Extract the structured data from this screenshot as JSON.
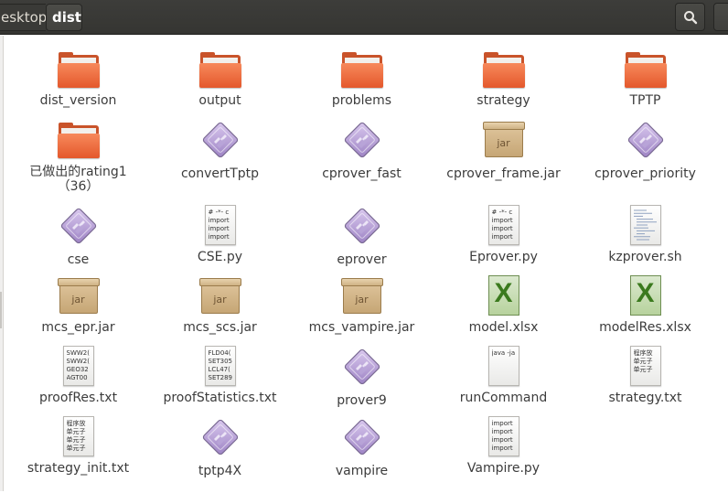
{
  "header": {
    "breadcrumb_prev": "esktop",
    "breadcrumb_current": "dist",
    "search_icon": "search-icon",
    "menu_icon": "menu-icon"
  },
  "files": [
    {
      "name": "dist_version",
      "type": "folder",
      "icon": "folder-icon"
    },
    {
      "name": "output",
      "type": "folder",
      "icon": "folder-icon"
    },
    {
      "name": "problems",
      "type": "folder",
      "icon": "folder-icon"
    },
    {
      "name": "strategy",
      "type": "folder",
      "icon": "folder-icon"
    },
    {
      "name": "TPTP",
      "type": "folder",
      "icon": "folder-icon"
    },
    {
      "name": "已做出的rating1\n（36）",
      "type": "folder",
      "icon": "folder-icon"
    },
    {
      "name": "convertTptp",
      "type": "exec",
      "icon": "executable-icon"
    },
    {
      "name": "cprover_fast",
      "type": "exec",
      "icon": "executable-icon"
    },
    {
      "name": "cprover_frame.jar",
      "type": "jar",
      "icon": "jar-icon",
      "preview": "jar"
    },
    {
      "name": "cprover_priority",
      "type": "exec",
      "icon": "executable-icon"
    },
    {
      "name": "cse",
      "type": "exec",
      "icon": "executable-icon"
    },
    {
      "name": "CSE.py",
      "type": "text",
      "icon": "python-file-icon",
      "preview": "# -*- c\nimport\nimport\nimport"
    },
    {
      "name": "eprover",
      "type": "exec",
      "icon": "executable-icon"
    },
    {
      "name": "Eprover.py",
      "type": "text",
      "icon": "python-file-icon",
      "preview": "# -*- c\nimport\nimport\nimport"
    },
    {
      "name": "kzprover.sh",
      "type": "script",
      "icon": "shell-script-icon"
    },
    {
      "name": "mcs_epr.jar",
      "type": "jar",
      "icon": "jar-icon",
      "preview": "jar"
    },
    {
      "name": "mcs_scs.jar",
      "type": "jar",
      "icon": "jar-icon",
      "preview": "jar"
    },
    {
      "name": "mcs_vampire.jar",
      "type": "jar",
      "icon": "jar-icon",
      "preview": "jar"
    },
    {
      "name": "model.xlsx",
      "type": "xlsx",
      "icon": "spreadsheet-icon",
      "preview": "X"
    },
    {
      "name": "modelRes.xlsx",
      "type": "xlsx",
      "icon": "spreadsheet-icon",
      "preview": "X"
    },
    {
      "name": "proofRes.txt",
      "type": "text",
      "icon": "text-file-icon",
      "preview": "SWW2(\nSWW2(\nGEO32\nAGT00"
    },
    {
      "name": "proofStatistics.txt",
      "type": "text",
      "icon": "text-file-icon",
      "preview": "FLD04(\nSET305\nLCL47(\nSET289"
    },
    {
      "name": "prover9",
      "type": "exec",
      "icon": "executable-icon"
    },
    {
      "name": "runCommand",
      "type": "text",
      "icon": "text-file-icon",
      "preview": "java -ja"
    },
    {
      "name": "strategy.txt",
      "type": "text",
      "icon": "text-file-icon",
      "preview": "程序放\n单元子\n单元子"
    },
    {
      "name": "strategy_init.txt",
      "type": "text",
      "icon": "text-file-icon",
      "preview": "程序放\n单元子\n单元子\n单元子"
    },
    {
      "name": "tptp4X",
      "type": "exec",
      "icon": "executable-icon"
    },
    {
      "name": "vampire",
      "type": "exec",
      "icon": "executable-icon"
    },
    {
      "name": "Vampire.py",
      "type": "text",
      "icon": "python-file-icon",
      "preview": "import\nimport\nimport\nimport"
    }
  ]
}
